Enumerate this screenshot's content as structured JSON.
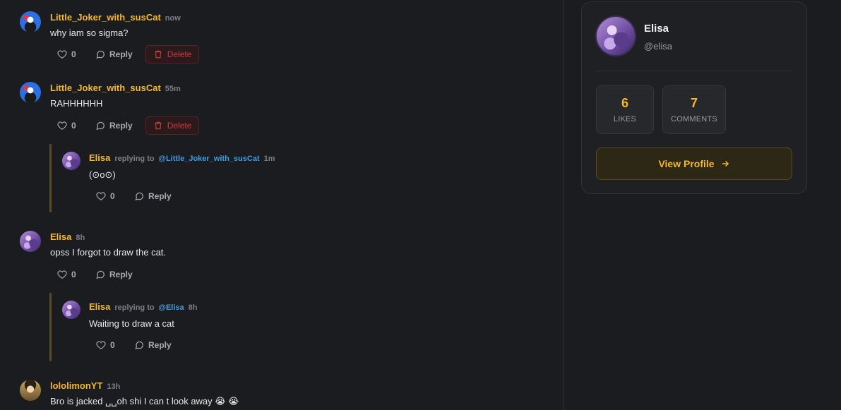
{
  "comments": [
    {
      "username": "Little_Joker_with_susCat",
      "time": "now",
      "text": "why iam so sigma?",
      "likes": "0",
      "reply_label": "Reply",
      "delete_label": "Delete"
    },
    {
      "username": "Little_Joker_with_susCat",
      "time": "55m",
      "text": "RAHHHHHH",
      "likes": "0",
      "reply_label": "Reply",
      "delete_label": "Delete",
      "replies": [
        {
          "username": "Elisa",
          "replying_label": "replying to",
          "replying_to": "@Little_Joker_with_susCat",
          "time": "1m",
          "text": "(⊙o⊙)",
          "likes": "0",
          "reply_label": "Reply"
        }
      ]
    },
    {
      "username": "Elisa",
      "time": "8h",
      "text": "opss I forgot to draw the cat.",
      "likes": "0",
      "reply_label": "Reply",
      "replies": [
        {
          "username": "Elisa",
          "replying_label": "replying to",
          "replying_to": "@Elisa",
          "time": "8h",
          "text": "Waiting to draw a cat",
          "likes": "0",
          "reply_label": "Reply"
        }
      ]
    },
    {
      "username": "lololimonYT",
      "time": "13h",
      "text": "Bro is jacked ␣␣oh shi I can t look away 😭 😭"
    }
  ],
  "profile_card": {
    "name": "Elisa",
    "handle": "@elisa",
    "stats": [
      {
        "value": "6",
        "label": "LIKES"
      },
      {
        "value": "7",
        "label": "COMMENTS"
      }
    ],
    "button_label": "View Profile",
    "button_icon": "arrow-right-icon"
  },
  "colors": {
    "accent": "#f5b82e",
    "mention": "#3d9ce6",
    "danger": "#d43a3a",
    "background": "#1b1c1f"
  }
}
